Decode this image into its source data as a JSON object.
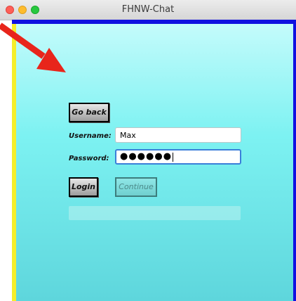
{
  "window": {
    "title": "FHNW-Chat"
  },
  "login_form": {
    "back_button": "Go back",
    "username_label": "Username:",
    "username_value": "Max",
    "password_label": "Password:",
    "password_masked": "●●●●●●",
    "login_button": "Login",
    "continue_button": "Continue"
  },
  "progress": {
    "fraction": 0
  },
  "annotation": {
    "arrow_color": "#e8251b"
  },
  "colors": {
    "frame_top": "#1010e0",
    "frame_left": "#f5ee2a",
    "content_top": "#c4fbfb",
    "content_bottom": "#5ed6dc"
  }
}
